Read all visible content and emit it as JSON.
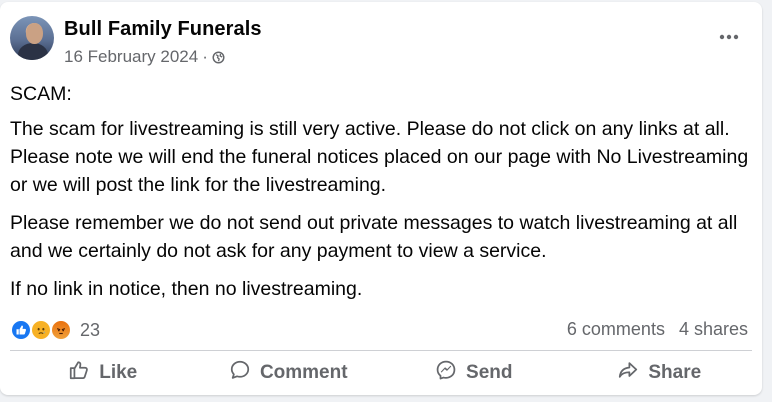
{
  "post": {
    "author": "Bull Family Funerals",
    "date": "16 February 2024",
    "separator": "·",
    "privacy_icon": "globe-icon",
    "more_icon": "more-horizontal-icon",
    "paragraphs": [
      "SCAM:",
      "The scam for livestreaming is still very active. Please do not click on any links at all. Please note we will end the funeral notices placed on our page with No Livestreaming or we will post the link for the livestreaming.",
      "Please remember we do not send out private messages to watch livestreaming at all and we certainly do not ask for any payment to view a service.",
      "If no link in notice, then no livestreaming."
    ]
  },
  "engagement": {
    "reaction_icons": [
      "like-reaction-icon",
      "sad-reaction-icon",
      "angry-reaction-icon"
    ],
    "reaction_count": "23",
    "comments": "6 comments",
    "shares": "4 shares"
  },
  "actions": {
    "like": "Like",
    "comment": "Comment",
    "send": "Send",
    "share": "Share"
  },
  "colors": {
    "text": "#050505",
    "secondary": "#65676b",
    "like_blue": "#1877f2",
    "sad_yellow": "#f7b125",
    "angry_orange": "#e9710f"
  }
}
